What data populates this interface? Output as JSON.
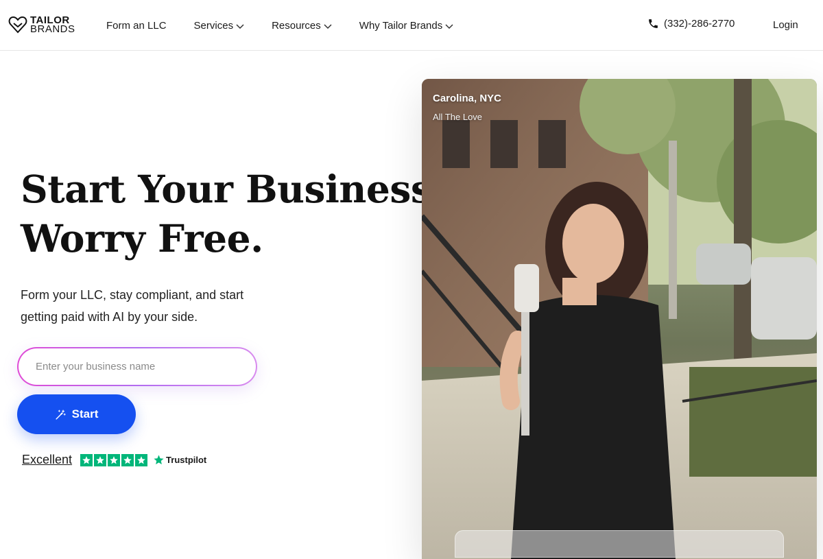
{
  "header": {
    "logo": {
      "line1": "TAILOR",
      "line2": "BRANDS"
    },
    "nav": [
      {
        "label": "Form an LLC",
        "has_dropdown": false
      },
      {
        "label": "Services",
        "has_dropdown": true
      },
      {
        "label": "Resources",
        "has_dropdown": true
      },
      {
        "label": "Why Tailor Brands",
        "has_dropdown": true
      }
    ],
    "phone": "(332)-286-2770",
    "login": "Login"
  },
  "hero": {
    "headline_line1": "Start Your Business.",
    "headline_line2": "Worry Free.",
    "subtext": "Form your LLC, stay compliant, and start getting paid with AI by your side.",
    "input_placeholder": "Enter your business name",
    "start_label": "Start",
    "trust": {
      "rating_word": "Excellent",
      "stars": 5,
      "brand": "Trustpilot"
    }
  },
  "photo_card": {
    "name": "Carolina, NYC",
    "caption": "All The Love"
  },
  "colors": {
    "primary_button": "#1550f0",
    "trustpilot_green": "#00b67a",
    "input_gradient_start": "#e04bd6",
    "input_gradient_end": "#d88aee"
  }
}
